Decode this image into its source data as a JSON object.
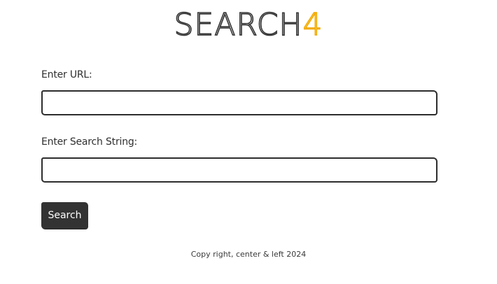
{
  "logo": {
    "main": "SEARCH",
    "accent": "4",
    "colors": {
      "main_stroke": "#333333",
      "accent_fill": "#ffd24a",
      "accent_stroke": "#f0a800"
    }
  },
  "form": {
    "url_label": "Enter URL:",
    "url_value": "",
    "search_label": "Enter Search String:",
    "search_value": "",
    "button_label": "Search"
  },
  "footer": {
    "text": "Copy right, center & left 2024"
  },
  "colors": {
    "button_bg": "#333333",
    "border": "#2d2d2d",
    "text": "#2b2b2b"
  }
}
